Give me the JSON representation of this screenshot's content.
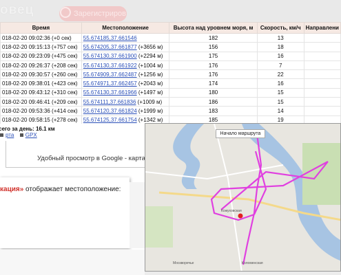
{
  "header": {
    "logo_text": "овец",
    "button_label": "Зарегистриров"
  },
  "table": {
    "headers": [
      "Время",
      "Местоположение",
      "Высота над уровнем моря, м",
      "Скорость, км/ч",
      "Направлени"
    ],
    "rows": [
      {
        "time": "018-02-20 09:02:36 (+0 сек)",
        "coords": "55.674185,37.661546",
        "delta": "",
        "alt": "182",
        "speed": "13"
      },
      {
        "time": "018-02-20 09:15:13 (+757 сек)",
        "coords": "55.674205,37.661877",
        "delta": " (+3656 м)",
        "alt": "156",
        "speed": "18"
      },
      {
        "time": "018-02-20 09:23:09 (+475 сек)",
        "coords": "55.674130,37.661900",
        "delta": " (+2294 м)",
        "alt": "175",
        "speed": "16"
      },
      {
        "time": "018-02-20 09:26:37 (+208 сек)",
        "coords": "55.674130,37.661922",
        "delta": " (+1004 м)",
        "alt": "176",
        "speed": "7"
      },
      {
        "time": "018-02-20 09:30:57 (+260 сек)",
        "coords": "55.674909,37.662487",
        "delta": " (+1256 м)",
        "alt": "176",
        "speed": "22"
      },
      {
        "time": "018-02-20 09:38:01 (+423 сек)",
        "coords": "55.674971,37.662457",
        "delta": " (+2043 м)",
        "alt": "174",
        "speed": "16"
      },
      {
        "time": "018-02-20 09:43:12 (+310 сек)",
        "coords": "55.674130,37.661966",
        "delta": " (+1497 м)",
        "alt": "180",
        "speed": "15"
      },
      {
        "time": "018-02-20 09:46:41 (+209 сек)",
        "coords": "55.674111,37.661836",
        "delta": " (+1009 м)",
        "alt": "186",
        "speed": "15"
      },
      {
        "time": "018-02-20 09:53:36 (+414 сек)",
        "coords": "55.674120,37.661824",
        "delta": " (+1999 м)",
        "alt": "183",
        "speed": "14"
      },
      {
        "time": "018-02-20 09:58:15 (+278 сек)",
        "coords": "55.674125,37.661754",
        "delta": " (+1342 м)",
        "alt": "185",
        "speed": "19"
      }
    ]
  },
  "summary": {
    "day_total": "сего за день: 16.1 км",
    "link_map": "рта",
    "link_gpx": "GPX"
  },
  "google_note": "Удобный просмотр в Google - картах",
  "card": {
    "highlight": "кация»",
    "text": " отображает местоположение:"
  },
  "map": {
    "route_button": "Начало маршрута",
    "labels": [
      "Кожуховская",
      "Москворечье",
      "Коломенская"
    ]
  },
  "colors": {
    "route": "#e040e0",
    "water": "#a7c4e3",
    "park": "#c9dfb3",
    "header_bg": "#f6e9e3",
    "accent_red": "#d0302a"
  }
}
